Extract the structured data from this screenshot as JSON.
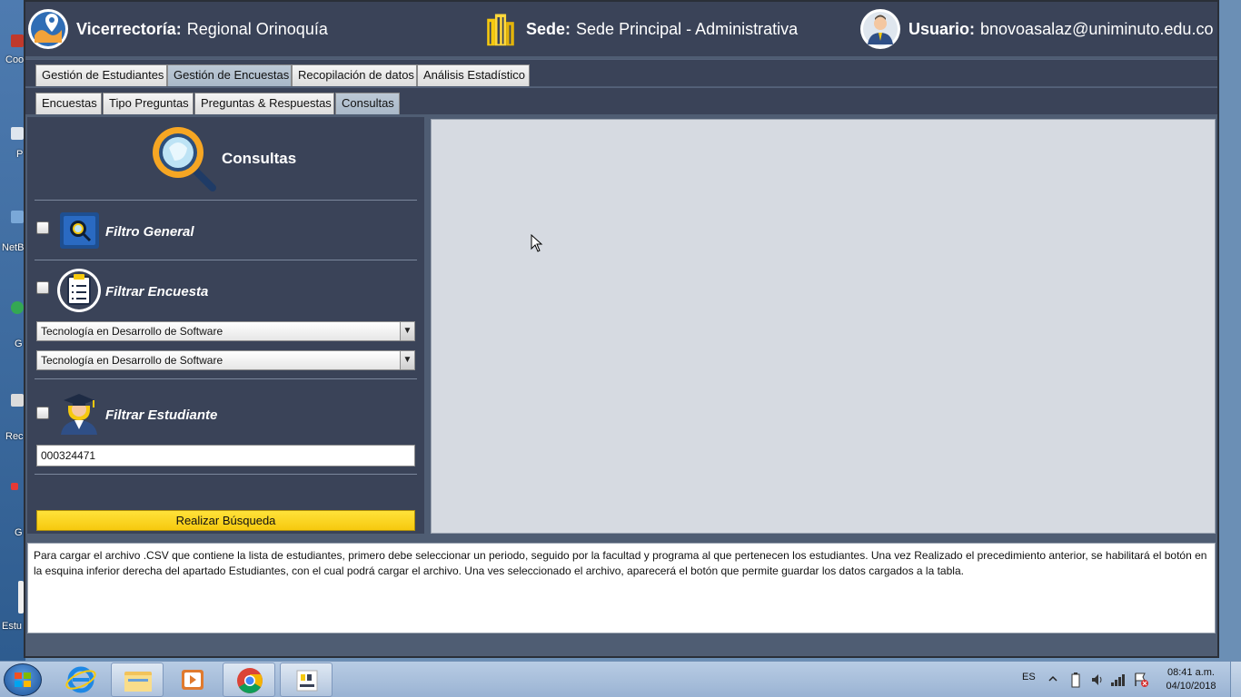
{
  "desktop": {
    "icons": [
      "Coo",
      "P De",
      "NetB",
      "G C",
      "Rec",
      "G C",
      "Estu"
    ]
  },
  "header": {
    "vicerrectoria_label": "Vicerrectoría:",
    "vicerrectoria_value": "Regional Orinoquía",
    "sede_label": "Sede:",
    "sede_value": "Sede Principal - Administrativa",
    "usuario_label": "Usuario:",
    "usuario_value": "bnovoasalaz@uniminuto.edu.co"
  },
  "main_tabs": [
    {
      "label": "Gestión de Estudiantes",
      "active": false
    },
    {
      "label": "Gestión de Encuestas",
      "active": true
    },
    {
      "label": "Recopilación de datos",
      "active": false
    },
    {
      "label": "Análisis Estadístico",
      "active": false
    }
  ],
  "sub_tabs": [
    {
      "label": "Encuestas",
      "active": false
    },
    {
      "label": "Tipo Preguntas",
      "active": false
    },
    {
      "label": "Preguntas & Respuestas",
      "active": false
    },
    {
      "label": "Consultas",
      "active": true
    }
  ],
  "left_panel": {
    "title": "Consultas",
    "filtro_general": {
      "label": "Filtro General",
      "checked": false
    },
    "filtrar_encuesta": {
      "label": "Filtrar Encuesta",
      "checked": false,
      "combo1_value": "Tecnología en Desarrollo de Software",
      "combo2_value": "Tecnología en Desarrollo de Software"
    },
    "filtrar_estudiante": {
      "label": "Filtrar Estudiante",
      "checked": false,
      "input_value": "000324471"
    },
    "search_button": "Realizar Búsqueda"
  },
  "info_text": "Para cargar el archivo .CSV que contiene la lista de estudiantes, primero debe seleccionar un periodo, seguido por la facultad y programa al que pertenecen los estudiantes. Una vez Realizado el precedimiento anterior, se habilitará el botón en la esquina inferior derecha del apartado Estudiantes, con el cual podrá cargar el archivo. Una ves seleccionado el archivo, aparecerá el botón que permite guardar los datos cargados a la tabla.",
  "taskbar": {
    "language": "ES",
    "time": "08:41 a.m.",
    "date": "04/10/2018",
    "pinned": [
      "internet-explorer",
      "file-explorer",
      "media-player",
      "chrome",
      "java-app"
    ]
  },
  "colors": {
    "header_bg": "#3a4358",
    "window_bg": "#4f5d73",
    "accent_yellow": "#f6c90e",
    "content_bg": "#d6dae1"
  }
}
